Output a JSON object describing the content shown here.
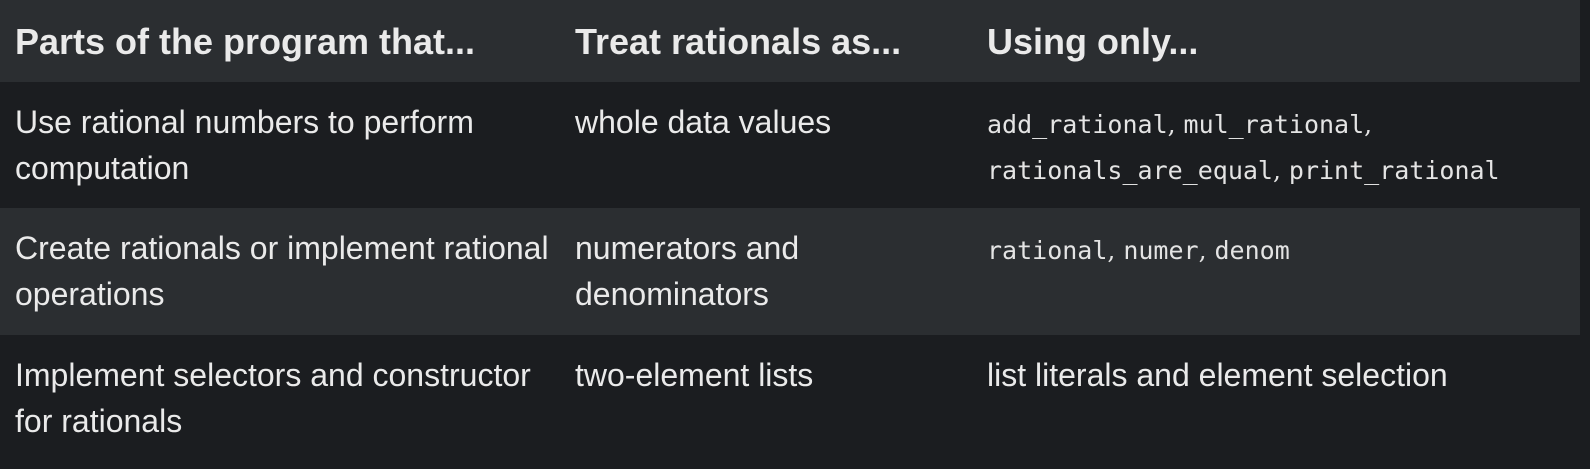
{
  "table": {
    "headers": [
      "Parts of the program that...",
      "Treat rationals as...",
      "Using only..."
    ],
    "rows": [
      {
        "parts": "Use rational numbers to perform computation",
        "treat_as": "whole data values",
        "using": [
          "add_rational",
          "mul_rational",
          "rationals_are_equal",
          "print_rational"
        ]
      },
      {
        "parts": "Create rationals or implement rational operations",
        "treat_as": "numerators and denominators",
        "using": [
          "rational",
          "numer",
          "denom"
        ]
      },
      {
        "parts": "Implement selectors and constructor for rationals",
        "treat_as": "two-element lists",
        "using_text": "list literals and element selection"
      }
    ]
  },
  "colors": {
    "header_bg": "#2b2e31",
    "row_bg_dark": "#1b1d20",
    "row_bg_light": "#2b2e31",
    "text": "#eaeaea"
  }
}
